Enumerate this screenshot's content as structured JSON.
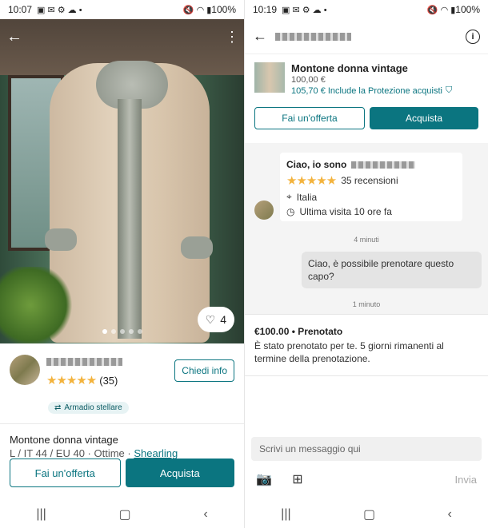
{
  "left": {
    "status": {
      "time": "10:07",
      "battery": "100%"
    },
    "photo": {
      "favorites": "4",
      "pages": 5,
      "active_page": 0
    },
    "seller": {
      "rating_count": "(35)",
      "ask_label": "Chiedi info",
      "badge": "Armadio stellare",
      "rating": 5
    },
    "item": {
      "title": "Montone donna vintage",
      "details": "L / IT 44 / EU 40 · Ottime ·",
      "material_link": "Shearling"
    },
    "cta": {
      "offer": "Fai un'offerta",
      "buy": "Acquista"
    }
  },
  "right": {
    "status": {
      "time": "10:19",
      "battery": "100%"
    },
    "product": {
      "title": "Montone donna vintage",
      "price": "100,00 €",
      "protection": "105,70 € Include la Protezione acquisti"
    },
    "cta": {
      "offer": "Fai un'offerta",
      "buy": "Acquista"
    },
    "card": {
      "greeting": "Ciao, io sono",
      "reviews": "35 recensioni",
      "location": "Italia",
      "last_seen": "Ultima visita 10 ore fa"
    },
    "times": {
      "t1": "4 minuti",
      "t2": "1 minuto"
    },
    "bubble": "Ciao, è possibile prenotare questo capo?",
    "reserved": {
      "head": "€100.00 • Prenotato",
      "desc": "È stato prenotato per te. 5 giorni rimanenti al termine della prenotazione."
    },
    "composer": {
      "placeholder": "Scrivi un messaggio qui",
      "send": "Invia"
    }
  },
  "colors": {
    "accent": "#0b7580",
    "star": "#f3b33d"
  },
  "icons": [
    "back-icon",
    "more-icon",
    "heart-icon",
    "star-icon",
    "wardrobe-icon",
    "info-icon",
    "shield-check-icon",
    "location-icon",
    "clock-icon",
    "camera-icon",
    "add-icon",
    "recents-icon",
    "home-icon",
    "nav-back-icon"
  ]
}
